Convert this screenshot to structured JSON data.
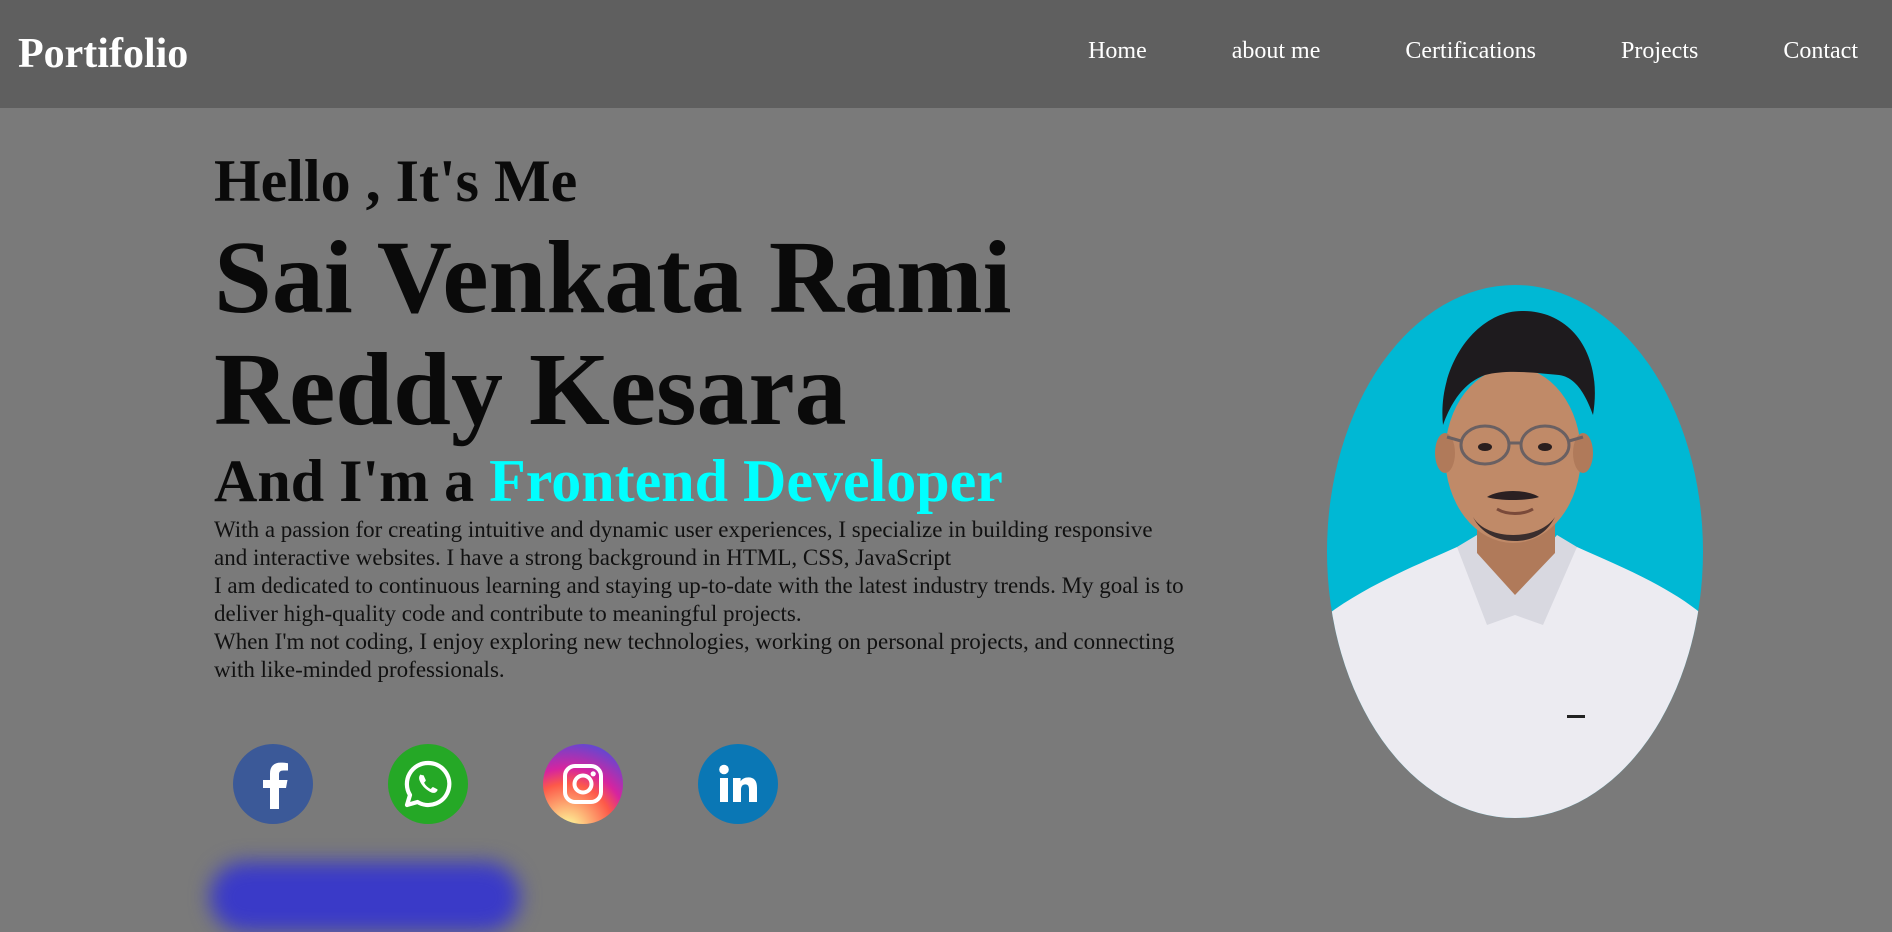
{
  "header": {
    "logo": "Portifolio",
    "nav": [
      "Home",
      "about me",
      "Certifications",
      "Projects",
      "Contact"
    ]
  },
  "hero": {
    "greeting": "Hello , It's Me",
    "name": "Sai Venkata Rami Reddy Kesara",
    "role_prefix": "And I'm a",
    "role_highlight": "Frontend Developer",
    "bio": [
      "With a passion for creating intuitive and dynamic user experiences, I specialize in building responsive and interactive websites. I have a strong background in HTML, CSS, JavaScript",
      "I am dedicated to continuous learning and staying up-to-date with the latest industry trends. My goal is to deliver high-quality code and contribute to meaningful projects.",
      "When I'm not coding, I enjoy exploring new technologies, working on personal projects, and connecting with like-minded professionals."
    ]
  },
  "socials": [
    {
      "icon": "facebook-icon"
    },
    {
      "icon": "whatsapp-icon"
    },
    {
      "icon": "instagram-icon"
    },
    {
      "icon": "linkedin-icon"
    }
  ],
  "colors": {
    "page_bg": "#7a7a7a",
    "nav_bg": "#5f5f5f",
    "accent": "#00ffff",
    "photo_bg": "#00b8d4",
    "cta": "#3a3ac8"
  }
}
